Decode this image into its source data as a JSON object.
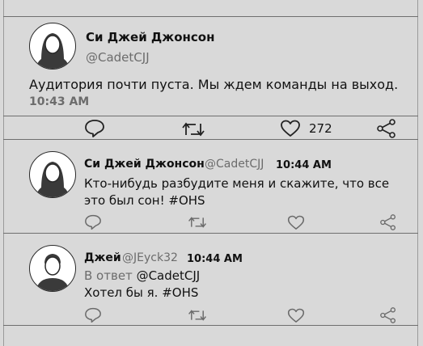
{
  "tweet1": {
    "name": "Си Джей Джонсон",
    "handle": "@CadetCJJ",
    "text": "Аудитория почти пуста. Мы ждем команды на выход.",
    "time": "10:43 AM",
    "like_count": "272"
  },
  "tweet2": {
    "name": "Си Джей Джонсон",
    "handle": "@CadetCJJ",
    "time": "10:44 AM",
    "text_line1": "Кто-нибудь разбудите меня и скажите, что все",
    "text_line2": "это был сон! #OHS"
  },
  "tweet3": {
    "name": "Джей",
    "handle": "@JEyck32",
    "time": "10:44 AM",
    "reply_prefix": "В ответ",
    "reply_handle": "@CadetCJJ",
    "text": "Хотел бы я. #OHS"
  },
  "icons": [
    "reply-icon",
    "retweet-icon",
    "like-icon",
    "share-icon"
  ]
}
